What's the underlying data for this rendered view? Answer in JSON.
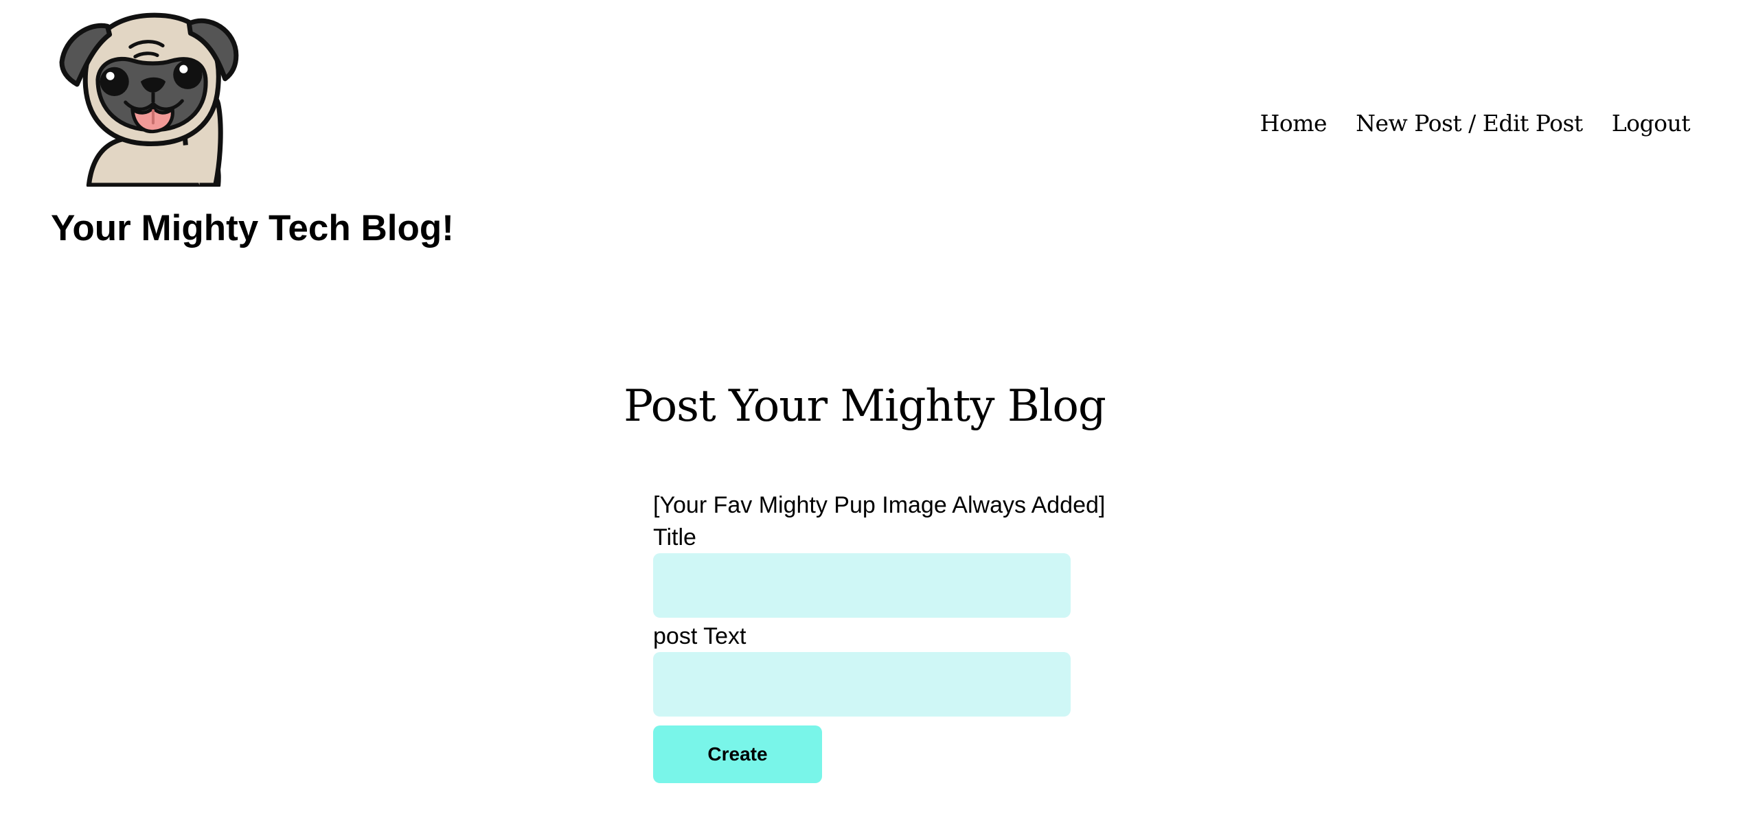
{
  "header": {
    "site_title": "Your Mighty Tech Blog!",
    "logo_icon": "pug-waving-icon"
  },
  "nav": {
    "home": "Home",
    "new_edit_post": "New Post / Edit Post",
    "logout": "Logout"
  },
  "main": {
    "heading": "Post Your Mighty Blog",
    "image_note": "[Your Fav Mighty Pup Image Always Added]",
    "title_label": "Title",
    "title_value": "",
    "post_text_label": "post Text",
    "post_text_value": "",
    "create_button": "Create"
  },
  "colors": {
    "input_background": "#cff7f6",
    "button_background": "#79f5e9"
  }
}
